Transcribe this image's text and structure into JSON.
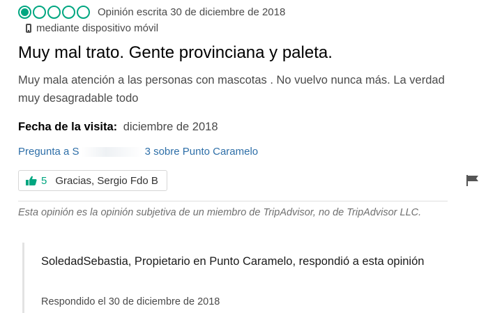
{
  "review": {
    "rating_bubbles": 1,
    "rating_max": 5,
    "date_text": "Opinión escrita 30 de diciembre de 2018",
    "device_text": "mediante dispositivo móvil",
    "title": "Muy mal trato. Gente provinciana y paleta.",
    "body": "Muy mala atención a las personas con mascotas . No vuelvo nunca más. La verdad muy desagradable todo",
    "visit_label": "Fecha de la visita:",
    "visit_value": "diciembre de 2018",
    "ask_prefix": "Pregunta a S",
    "ask_suffix": "3 sobre Punto Caramelo",
    "thanks_count": "5",
    "thanks_label": "Gracias, Sergio Fdo B",
    "disclaimer": "Esta opinión es la opinión subjetiva de un miembro de TripAdvisor, no de TripAdvisor LLC."
  },
  "response": {
    "header": "SoledadSebastia, Propietario en Punto Caramelo, respondió a esta opinión",
    "date_text": "Respondido el 30 de diciembre de 2018"
  },
  "colors": {
    "accent": "#00a680",
    "link": "#2e6fa8"
  },
  "icons": {
    "device": "mobile-phone-icon",
    "thanks": "thumbs-up-icon",
    "report": "flag-icon"
  }
}
